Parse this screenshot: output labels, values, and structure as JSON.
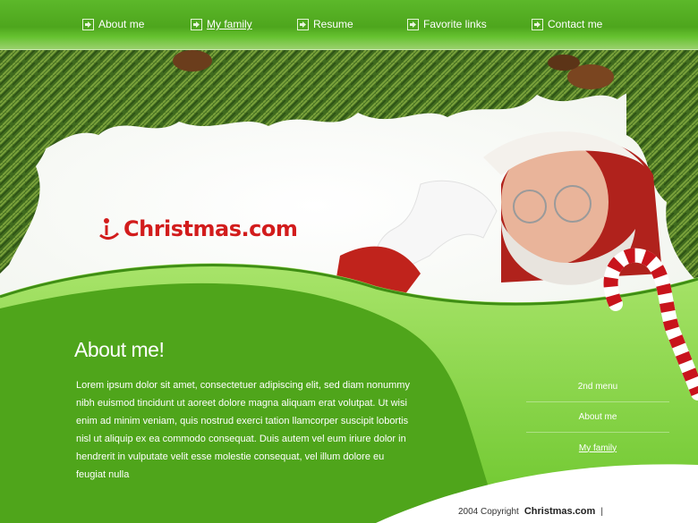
{
  "nav": {
    "items": [
      {
        "label": "About me",
        "icon": "arrow-box-icon"
      },
      {
        "label": "My family",
        "icon": "arrow-box-icon",
        "active": true
      },
      {
        "label": "Resume",
        "icon": "arrow-box-icon"
      },
      {
        "label": "Favorite links",
        "icon": "arrow-box-icon"
      },
      {
        "label": "Contact me",
        "icon": "arrow-box-icon"
      }
    ]
  },
  "logo": {
    "text": "Christmas.com",
    "color": "#d21c1c"
  },
  "about": {
    "title": "About me!",
    "paragraph": "Lorem ipsum dolor sit amet, consectetuer adipiscing elit, sed diam nonummy nibh euismod tincidunt ut aoreet dolore magna aliquam erat volutpat. Ut wisi enim ad minim veniam, quis nostrud exerci tation llamcorper suscipit lobortis nisl ut aliquip ex ea commodo consequat. Duis autem vel eum iriure dolor in hendrerit in vulputate velit esse molestie consequat, vel illum dolore eu feugiat nulla"
  },
  "side_menu": {
    "items": [
      "2nd menu",
      "About me",
      "My family"
    ]
  },
  "footer": {
    "prefix": "2004 Copyright",
    "brand": "Christmas.com",
    "separator": "|"
  },
  "colors": {
    "green": "#4fa51b",
    "light_green": "#8ed84e",
    "red": "#d21c1c"
  }
}
